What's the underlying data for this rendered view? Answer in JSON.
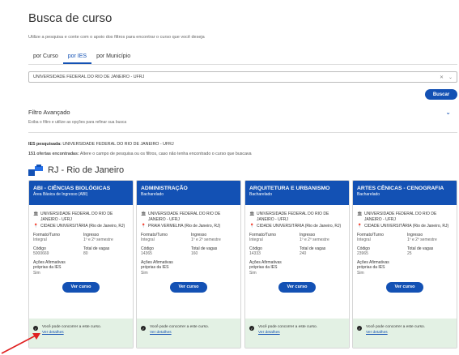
{
  "page": {
    "title": "Busca de curso",
    "subtitle": "Utilize a pesquisa e conte com o apoio dos filtros para encontrar o curso que você deseja"
  },
  "tabs": [
    {
      "label": "por Curso"
    },
    {
      "label": "por IES"
    },
    {
      "label": "por Município"
    }
  ],
  "search": {
    "value": "UNIVERSIDADE FEDERAL DO RIO DE JANEIRO - UFRJ",
    "button": "Buscar"
  },
  "filter": {
    "title": "Filtro Avançado",
    "subtitle": "Exiba o filtro e utilize as opções para refinar sua busca"
  },
  "results": {
    "ies_label": "IES pesquisada:",
    "ies_value": "UNIVERSIDADE FEDERAL DO RIO DE JANEIRO - UFRJ",
    "count_label": "151 ofertas encontradas:",
    "count_text": "Altere o campo de pesquisa ou os filtros, caso não tenha encontrado o curso que buscava"
  },
  "region": {
    "label": "RJ - Rio de Janeiro"
  },
  "card_labels": {
    "formato": "Formato/Turno",
    "ingresso": "Ingresso",
    "codigo": "Código",
    "vagas": "Total de vagas",
    "acoes": "Ações Afirmativas próprias da IES",
    "ver": "Ver curso",
    "foot": "Você pode concorrer a este curso.",
    "detalhes": "Ver detalhes"
  },
  "cards": [
    {
      "title": "ABI - CIÊNCIAS BIOLÓGICAS",
      "subtitle": "Área Básica de Ingresso (ABI)",
      "ies": "UNIVERSIDADE FEDERAL DO RIO DE JANEIRO - UFRJ",
      "campus": "CIDADE UNIVERSITÁRIA (Rio de Janeiro, RJ)",
      "formato": "Integral",
      "ingresso": "1º e 2º semestre",
      "codigo": "5000669",
      "vagas": "80",
      "acoes": "Sim"
    },
    {
      "title": "ADMINISTRAÇÃO",
      "subtitle": "Bacharelado",
      "ies": "UNIVERSIDADE FEDERAL DO RIO DE JANEIRO - UFRJ",
      "campus": "PRAIA VERMELHA (Rio de Janeiro, RJ)",
      "formato": "Integral",
      "ingresso": "1º e 2º semestre",
      "codigo": "14365",
      "vagas": "160",
      "acoes": "Sim"
    },
    {
      "title": "ARQUITETURA E URBANISMO",
      "subtitle": "Bacharelado",
      "ies": "UNIVERSIDADE FEDERAL DO RIO DE JANEIRO - UFRJ",
      "campus": "CIDADE UNIVERSITÁRIA (Rio de Janeiro, RJ)",
      "formato": "Integral",
      "ingresso": "1º e 2º semestre",
      "codigo": "14333",
      "vagas": "240",
      "acoes": "Sim"
    },
    {
      "title": "ARTES CÊNICAS - CENOGRAFIA",
      "subtitle": "Bacharelado",
      "ies": "UNIVERSIDADE FEDERAL DO RIO DE JANEIRO - UFRJ",
      "campus": "CIDADE UNIVERSITÁRIA (Rio de Janeiro, RJ)",
      "formato": "Integral",
      "ingresso": "1º e 2º semestre",
      "codigo": "23965",
      "vagas": "25",
      "acoes": "Sim"
    }
  ],
  "colors": {
    "primary": "#1351b4",
    "success_bg": "#e3f1e4",
    "annotation_arrow": "#e02020"
  }
}
